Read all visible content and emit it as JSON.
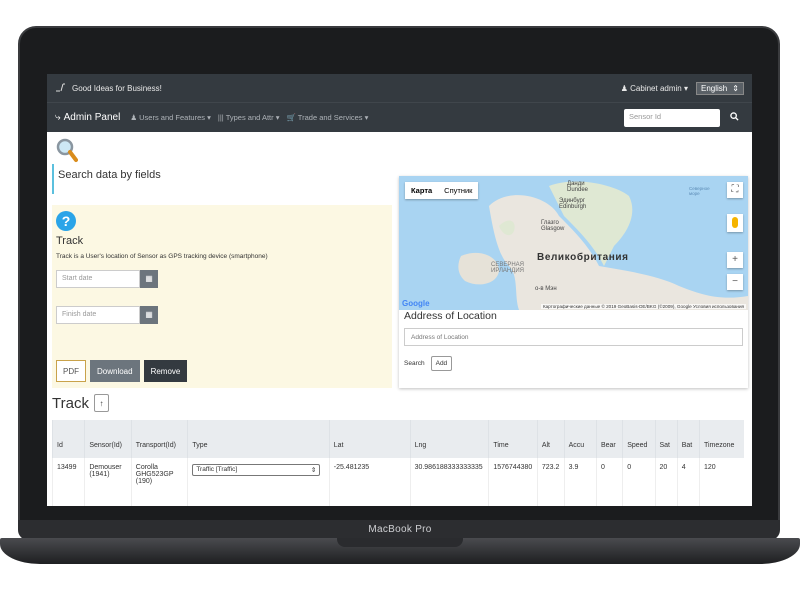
{
  "device": {
    "label": "MacBook Pro"
  },
  "topbar": {
    "logo_text": "Good Ideas for Business!",
    "cabinet": "Cabinet admin",
    "language": "English"
  },
  "navbar": {
    "title": "Admin Panel",
    "items": [
      {
        "label": "Users and Features"
      },
      {
        "label": "Types and Attr"
      },
      {
        "label": "Trade and Services"
      }
    ],
    "search_placeholder": "Sensor Id"
  },
  "search_section": {
    "title": "Search data by fields"
  },
  "track_panel": {
    "title": "Track",
    "description": "Track is a User's location of Sensor as GPS tracking device (smartphone)",
    "start_placeholder": "Start date",
    "finish_placeholder": "Finish date",
    "buttons": {
      "pdf": "PDF",
      "download": "Download",
      "remove": "Remove"
    }
  },
  "map": {
    "tab_map": "Карта",
    "tab_satellite": "Спутник",
    "labels": {
      "dundee": "Данди\nDundee",
      "edinburgh": "Эдинбург\nEdinburgh",
      "glasgow": "Глазго\nGlasgow",
      "uk": "Великобритания",
      "ni": "СЕВЕРНАЯ\nИРЛАНДИЯ",
      "isle": "о-в Мэн",
      "north_sea": "Северное\nморе"
    },
    "google": "Google",
    "attribution": "Картографические данные © 2019 GeoBasis-DE/BKG (©2009), Google   Условия использования"
  },
  "address": {
    "title": "Address of Location",
    "placeholder": "Address of Location",
    "search": "Search",
    "add": "Add"
  },
  "track_table": {
    "title": "Track",
    "sort_icon": "↑",
    "columns": [
      "Id",
      "Sensor(Id)",
      "Transport(Id)",
      "Type",
      "Lat",
      "Lng",
      "Time",
      "Alt",
      "Accu",
      "Bear",
      "Speed",
      "Sat",
      "Bat",
      "Timezone"
    ],
    "rows": [
      {
        "id": "13499",
        "sensor": "Demouser\n(1941)",
        "transport": "Corolla\nGHG523GP\n(190)",
        "type": "Traffic [Traffic]",
        "lat": "-25.481235",
        "lng": "30.986188333333335",
        "time": "1576744380",
        "alt": "723.2",
        "accu": "3.9",
        "bear": "0",
        "speed": "0",
        "sat": "20",
        "bat": "4",
        "timezone": "120"
      }
    ]
  }
}
